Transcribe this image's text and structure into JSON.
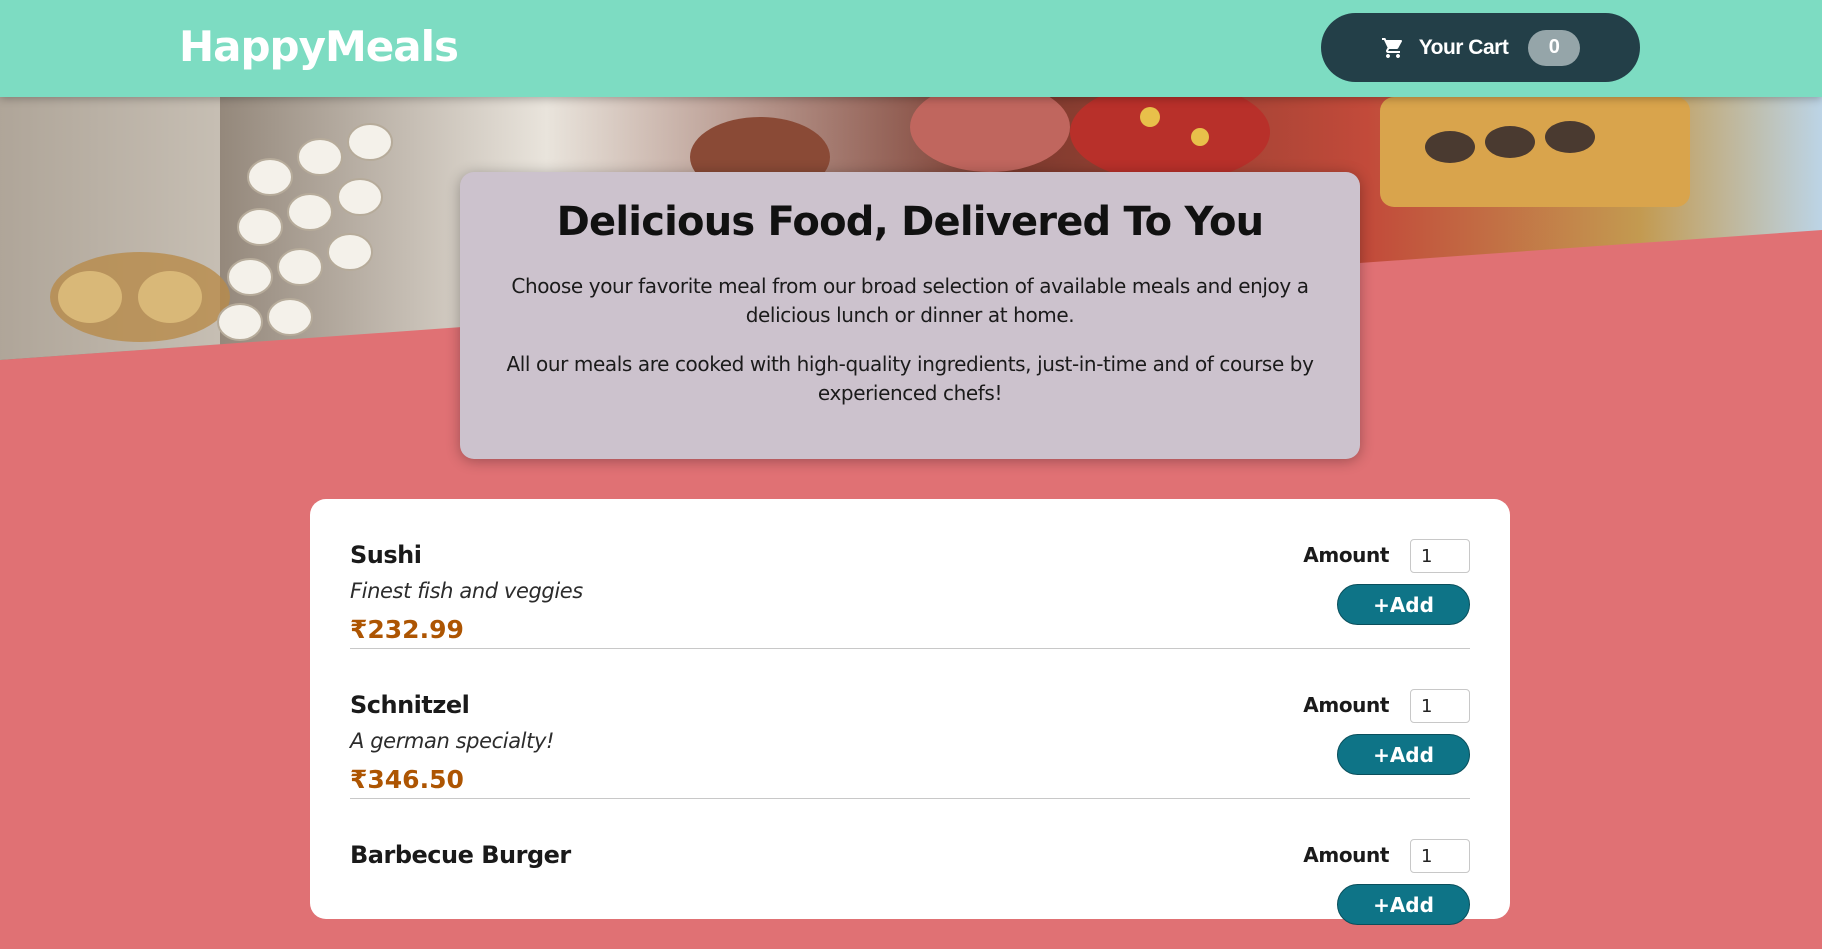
{
  "header": {
    "logo": "HappyMeals",
    "cart_label": "Your Cart",
    "cart_count": "0",
    "cart_icon": "cart-icon"
  },
  "summary": {
    "title": "Delicious Food, Delivered To You",
    "paragraph_1": "Choose your favorite meal from our broad selection of available meals and enjoy a delicious lunch or dinner at home.",
    "paragraph_2": "All our meals are cooked with high-quality ingredients, just-in-time and of course by experienced chefs!"
  },
  "meals": [
    {
      "name": "Sushi",
      "description": "Finest fish and veggies",
      "price": "₹232.99",
      "amount_label": "Amount",
      "amount_value": "1",
      "add_label": "+Add"
    },
    {
      "name": "Schnitzel",
      "description": "A german specialty!",
      "price": "₹346.50",
      "amount_label": "Amount",
      "amount_value": "1",
      "add_label": "+Add"
    },
    {
      "name": "Barbecue Burger",
      "description": "",
      "price": "",
      "amount_label": "Amount",
      "amount_value": "1",
      "add_label": "+Add"
    }
  ],
  "colors": {
    "header_bg": "#7ddcc2",
    "page_bg": "#e07174",
    "cart_bg": "#233f48",
    "summary_bg": "#ccc2cd",
    "add_button": "#0e7487",
    "price": "#ad5502"
  }
}
